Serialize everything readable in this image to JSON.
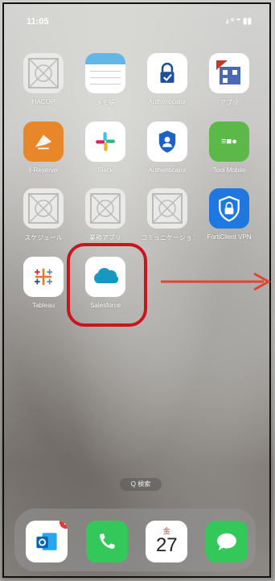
{
  "status_bar": {
    "time": "11:05",
    "signal": "ᵢₗ ᵒ ⁼ ▮▮"
  },
  "home": {
    "apps": [
      {
        "label": "HACOP",
        "icon": "placeholder-icon"
      },
      {
        "label": "メモ帳",
        "icon": "notes-icon"
      },
      {
        "label": "Authenticator",
        "icon": "authenticator-lock-icon"
      },
      {
        "label": "アプリ",
        "icon": "qr-app-icon"
      },
      {
        "label": "I-Reserve",
        "icon": "reserve-icon"
      },
      {
        "label": "Slack",
        "icon": "slack-icon"
      },
      {
        "label": "Authenticator",
        "icon": "authenticator-person-icon"
      },
      {
        "label": "Tool Mobile",
        "icon": "tool-mobile-icon"
      },
      {
        "label": "スケジュール",
        "icon": "placeholder-icon"
      },
      {
        "label": "業務アプリ",
        "icon": "placeholder-icon"
      },
      {
        "label": "コミュニケーション",
        "icon": "placeholder-icon"
      },
      {
        "label": "FortiClient VPN",
        "icon": "shield-lock-icon"
      },
      {
        "label": "Tableau",
        "icon": "tableau-icon"
      },
      {
        "label": "Salesforce",
        "icon": "salesforce-cloud-icon"
      }
    ],
    "page_indicator": "Q 検索"
  },
  "dock": {
    "apps": [
      {
        "name": "Outlook",
        "icon": "outlook-icon",
        "badge": "2"
      },
      {
        "name": "Phone",
        "icon": "phone-icon"
      },
      {
        "name": "Calendar",
        "icon": "calendar-icon",
        "day": "27",
        "weekday": "金"
      },
      {
        "name": "Messages",
        "icon": "messages-icon"
      }
    ]
  },
  "annotation": {
    "color": "#c8161c"
  }
}
